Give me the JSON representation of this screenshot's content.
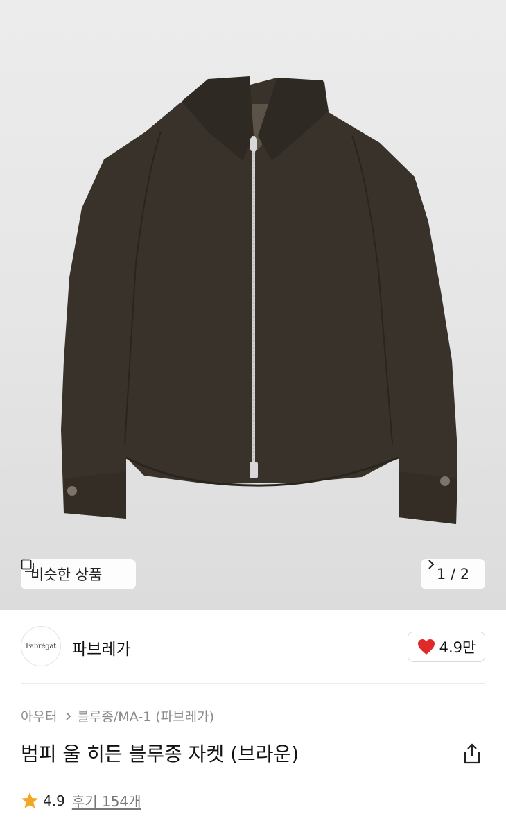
{
  "gallery": {
    "similar_label": "비슷한 상품",
    "page_indicator": "1 / 2",
    "icons": {
      "similar": "similar-products-icon",
      "next": "chevron-right-icon"
    }
  },
  "brand": {
    "logo_text": "Fabrégat",
    "name": "파브레가",
    "likes": "4.9만",
    "like_icon": "heart-icon",
    "like_color": "#e02a2a"
  },
  "breadcrumb": {
    "level1": "아우터",
    "level2": "블루종/MA-1 (파브레가)"
  },
  "product": {
    "title": "범피 울 히든 블루종 자켓 (브라운)",
    "rating": "4.9",
    "reviews": "후기 154개",
    "star_color": "#f5a623",
    "share_icon": "share-icon"
  }
}
